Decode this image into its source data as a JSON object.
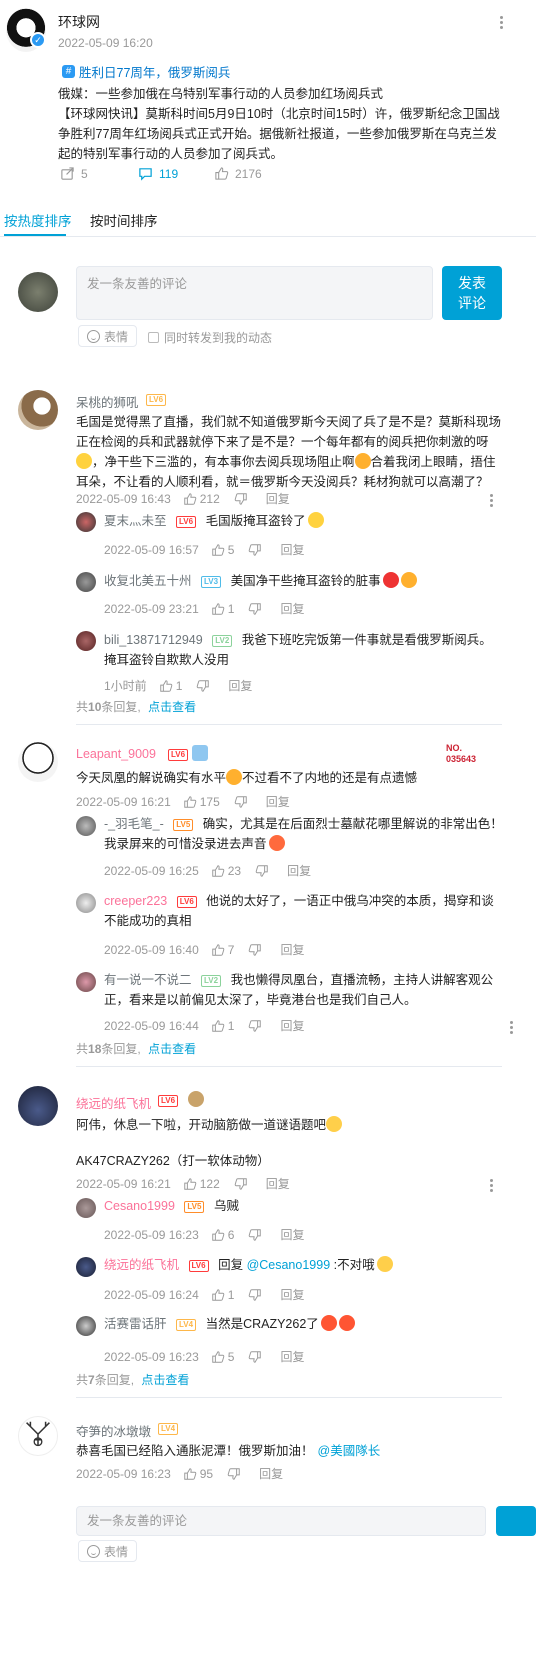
{
  "post": {
    "author": "环球网",
    "time": "2022-05-09 16:20",
    "topic": "胜利日77周年，俄罗斯阅兵",
    "body_line1": "俄媒：一些参加俄在乌特别军事行动的人员参加红场阅兵式",
    "body_line2": "【环球网快讯】莫斯科时间5月9日10时（北京时间15时）许，俄罗斯纪念卫国战",
    "body_line3": "争胜利77周年红场阅兵式正式开始。据俄新社报道，一些参加俄罗斯在乌克兰发",
    "body_line4": "起的特别军事行动的人员参加了阅兵式。",
    "shares": "5",
    "comments": "119",
    "likes": "2176"
  },
  "tabs": {
    "hot": "按热度排序",
    "time": "按时间排序"
  },
  "composer": {
    "placeholder": "发一条友善的评论",
    "send_label": "发表\n评论",
    "send_line1": "发表",
    "send_line2": "评论",
    "emoji_label": "表情",
    "forward_label": "同时转发到我的动态"
  },
  "labels": {
    "reply": "回复",
    "total_prefix": "共",
    "total_suffix": "条回复,",
    "view_more": "点击查看"
  },
  "comments": [
    {
      "user": "呆桃的狮吼",
      "level": "LV6",
      "text": "毛国是觉得黑了直播，我们就不知道俄罗斯今天阅了兵了是不是？莫斯科现场正在检阅的兵和武器就停下来了是不是？一个每年都有的阅兵把你刺激的呀",
      "text2": "，净干些下三滥的，有本事你去阅兵现场阻止啊",
      "text3": "合着我闭上眼睛，捂住耳朵，不让看的人顺利看，就＝俄罗斯今天没阅兵？耗材狗就可以高潮了？",
      "time": "2022-05-09 16:43",
      "likes": "212",
      "replies": [
        {
          "user": "夏末灬未至",
          "level": "LV6",
          "text": "毛国版掩耳盗铃了",
          "time": "2022-05-09 16:57",
          "likes": "5"
        },
        {
          "user": "收复北美五十州",
          "level": "LV3",
          "text": "美国净干些掩耳盗铃的脏事",
          "time": "2022-05-09 23:21",
          "likes": "1"
        },
        {
          "user": "bili_13871712949",
          "level": "LV2",
          "text": "我爸下班吃完饭第一件事就是看俄罗斯阅兵。掩耳盗铃自欺欺人没用",
          "time": "1小时前",
          "likes": "1"
        }
      ],
      "total": "10"
    },
    {
      "user": "Leapant_9009",
      "level": "LV6",
      "badge_title": "NO.",
      "badge_number": "035643",
      "text": "今天凤凰的解说确实有水平",
      "text2": "不过看不了内地的还是有点遗憾",
      "time": "2022-05-09 16:21",
      "likes": "175",
      "replies": [
        {
          "user": "-_羽毛笔_-",
          "level": "LV5",
          "text": "确实，尤其是在后面烈士墓献花哪里解说的非常出色！我录屏来的可惜没录进去声音",
          "time": "2022-05-09 16:25",
          "likes": "23"
        },
        {
          "user": "creeper223",
          "level": "LV6",
          "text": "他说的太好了，一语正中俄乌冲突的本质，揭穿和谈不能成功的真相",
          "time": "2022-05-09 16:40",
          "likes": "7"
        },
        {
          "user": "有一说一不说二",
          "level": "LV2",
          "text": "我也懒得凤凰台，直播流畅，主持人讲解客观公正，看来是以前偏见太深了，毕竟港台也是我们自己人。",
          "time": "2022-05-09 16:44",
          "likes": "1"
        }
      ],
      "total": "18"
    },
    {
      "user": "绕远的纸飞机",
      "level": "LV6",
      "text": "阿伟，休息一下啦，开动脑筋做一道谜语题吧",
      "text2": "AK47CRAZY262（打一软体动物）",
      "time": "2022-05-09 16:21",
      "likes": "122",
      "replies": [
        {
          "user": "Cesano1999",
          "level": "LV5",
          "text": "乌贼",
          "time": "2022-05-09 16:23",
          "likes": "6"
        },
        {
          "user": "绕远的纸飞机",
          "level": "LV6",
          "text_prefix": "回复",
          "mention": "@Cesano1999",
          "text": " :不对哦",
          "time": "2022-05-09 16:24",
          "likes": "1"
        },
        {
          "user": "活赛雷话肝",
          "level": "LV4",
          "text": "当然是CRAZY262了",
          "time": "2022-05-09 16:23",
          "likes": "5"
        }
      ],
      "total": "7"
    },
    {
      "user": "夺笋的冰墩墩",
      "level": "LV4",
      "text": "恭喜毛国已经陷入通胀泥潭！俄罗斯加油！",
      "mention": "@美國隊长",
      "time": "2022-05-09 16:23",
      "likes": "95"
    }
  ],
  "colors": {
    "accent": "#00a1d6",
    "pink_name": "#fb7299",
    "lv6": "#ff3b3b",
    "lv5": "#ff8d2a",
    "lv3": "#4fbbe8",
    "lv2": "#8bd29b",
    "lv4": "#fdb74a"
  },
  "icons": [
    "share-icon",
    "comment-icon",
    "like-icon",
    "dislike-icon",
    "more-vertical-icon",
    "topic-hash-icon",
    "verified-icon",
    "emoji-icon"
  ]
}
